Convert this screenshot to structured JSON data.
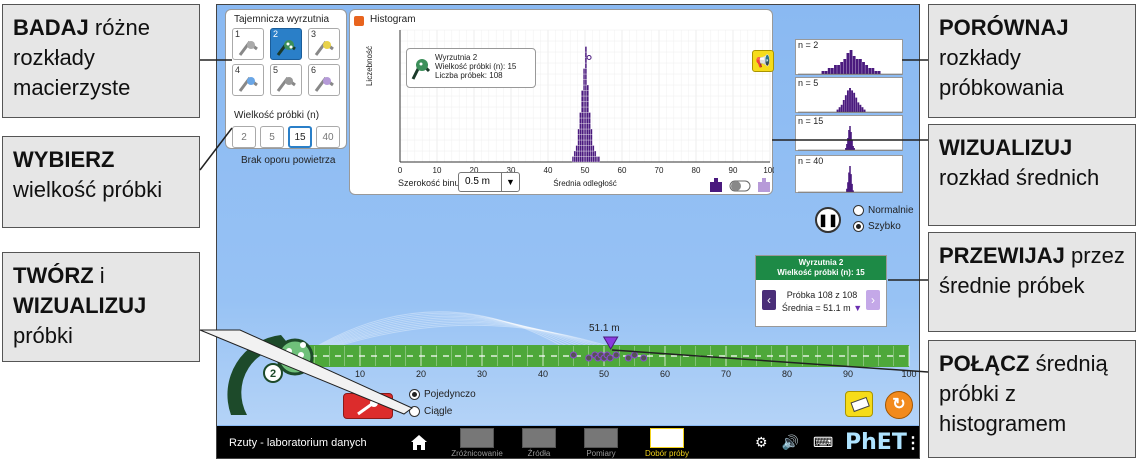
{
  "callouts": [
    {
      "id": "explore",
      "bold": "BADAJ",
      "rest": " różne rozkłady macierzyste"
    },
    {
      "id": "choose",
      "bold": "WYBIERZ",
      "rest": " wielkość próbki"
    },
    {
      "id": "create",
      "bold": "TWÓRZ",
      "mid": " i ",
      "bold2": "WIZUALIZUJ",
      "rest": " próbki"
    },
    {
      "id": "compare",
      "bold": "PORÓWNAJ",
      "rest": " rozkłady próbkowania"
    },
    {
      "id": "visualize",
      "bold": "WIZUALIZUJ",
      "rest": " rozkład średnich"
    },
    {
      "id": "scroll",
      "bold": "PRZEWIJAJ",
      "rest": " przez średnie próbek"
    },
    {
      "id": "connect",
      "bold": "POŁĄCZ",
      "rest": " średnią próbki z histogramem"
    }
  ],
  "launcher_panel": {
    "title": "Tajemnicza wyrzutnia",
    "launchers": [
      "1",
      "2",
      "3",
      "4",
      "5",
      "6"
    ],
    "selected": "2",
    "sample_size_title": "Wielkość próbki (n)",
    "sample_sizes": [
      "2",
      "5",
      "15",
      "40"
    ],
    "selected_size": "15",
    "air_resistance": "Brak oporu powietrza"
  },
  "zoom": {
    "plus": "+",
    "minus": "−"
  },
  "histogram": {
    "title": "Histogram",
    "ylabel": "Liczebność",
    "xlabel": "Średnia odległość",
    "legend": {
      "launcher": "Wyrzutnia 2",
      "sample_size": "Wielkość próbki (n): 15",
      "sample_count": "Liczba próbek: 108"
    },
    "bin_label": "Szerokość binu",
    "bin_value": "0.5 m",
    "sound_icon": "megaphone-icon"
  },
  "chart_data": {
    "type": "bar",
    "title": "Histogram",
    "xlabel": "Średnia odległość",
    "ylabel": "Liczebność",
    "xlim": [
      0,
      100
    ],
    "x_ticks": [
      0,
      10,
      20,
      30,
      40,
      50,
      60,
      70,
      80,
      90,
      100
    ],
    "bin_width": 0.5,
    "x": [
      46.5,
      47,
      47.5,
      48,
      48.5,
      49,
      49.5,
      50,
      50.5,
      51,
      51.5,
      52,
      52.5,
      53,
      53.5
    ],
    "values": [
      1,
      2,
      3,
      6,
      9,
      13,
      17,
      21,
      14,
      9,
      6,
      3,
      2,
      1,
      1
    ]
  },
  "mini_histograms": [
    {
      "label": "n = 2",
      "x": [
        24,
        27,
        30,
        33,
        36,
        39,
        42,
        45,
        48,
        51,
        54,
        57,
        60,
        63,
        66,
        69,
        72,
        75,
        78
      ],
      "values": [
        1,
        1,
        2,
        2,
        3,
        3,
        4,
        5,
        7,
        8,
        6,
        5,
        5,
        4,
        3,
        2,
        2,
        1,
        1
      ]
    },
    {
      "label": "n = 5",
      "x": [
        38,
        40,
        42,
        44,
        46,
        48,
        50,
        52,
        54,
        56,
        58,
        60,
        62,
        64
      ],
      "values": [
        1,
        2,
        3,
        5,
        7,
        9,
        10,
        9,
        8,
        6,
        4,
        3,
        2,
        1
      ]
    },
    {
      "label": "n = 15",
      "x": [
        46,
        47,
        48,
        49,
        50,
        51,
        52,
        53,
        54
      ],
      "values": [
        1,
        3,
        6,
        10,
        12,
        9,
        5,
        2,
        1
      ]
    },
    {
      "label": "n = 40",
      "x": [
        47,
        48,
        49,
        50,
        51,
        52,
        53
      ],
      "values": [
        2,
        6,
        12,
        16,
        11,
        5,
        1
      ]
    }
  ],
  "speed": {
    "normal": "Normalnie",
    "fast": "Szybko",
    "selected": "fast"
  },
  "sample_card": {
    "header_line1": "Wyrzutnia 2",
    "header_line2": "Wielkość próbki (n): 15",
    "count": "Próbka 108 z 108",
    "mean": "Średnia = 51.1 m"
  },
  "field": {
    "ticks": [
      "10",
      "20",
      "30",
      "40",
      "50",
      "60",
      "70",
      "80",
      "90",
      "100"
    ],
    "mean_label": "51.1 m",
    "mean_value": 51.1,
    "landed": [
      45,
      47.5,
      48.5,
      49,
      49.5,
      50,
      50.5,
      51,
      52,
      54,
      55,
      56.5
    ]
  },
  "launch_mode": {
    "single": "Pojedynczo",
    "continuous": "Ciągle",
    "selected": "single"
  },
  "launcher_label": "2",
  "navbar": {
    "sim_title": "Rzuty - laboratorium danych",
    "tabs": [
      "Zróżnicowanie",
      "Źródła",
      "Pomiary",
      "Dobór próby"
    ],
    "active_tab": "Dobór próby",
    "logo": "PhET"
  },
  "colors": {
    "bar": "#4a1a7e",
    "field": "#4ea83a",
    "sky": "#8ab9f2",
    "accent_green": "#1d8a46"
  }
}
